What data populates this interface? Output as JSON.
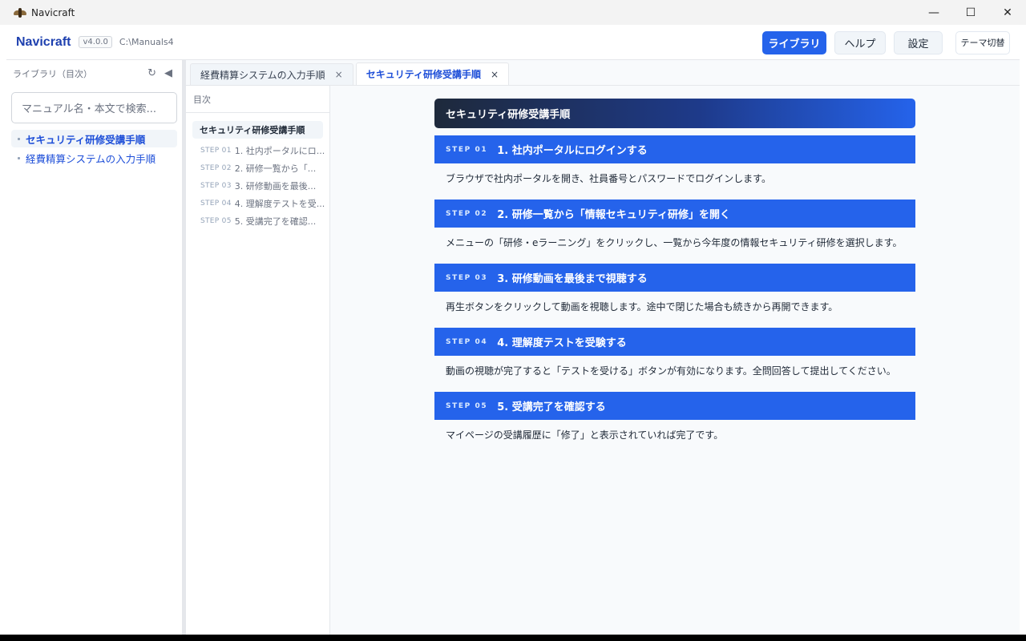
{
  "window": {
    "title": "Navicraft",
    "controls": {
      "minimize": "—",
      "maximize": "☐",
      "close": "✕"
    }
  },
  "header": {
    "brand": "Navicraft",
    "version": "v4.0.0",
    "path": "C:\\Manuals4",
    "buttons": {
      "library": "ライブラリ",
      "help": "ヘルプ",
      "settings": "設定",
      "theme": "テーマ切替"
    }
  },
  "sidebar": {
    "title": "ライブラリ（目次）",
    "refresh_icon": "↻",
    "collapse_icon": "◀",
    "search_placeholder": "マニュアル名・本文で検索...",
    "items": [
      {
        "label": "セキュリティ研修受講手順",
        "active": true
      },
      {
        "label": "経費精算システムの入力手順",
        "active": false
      }
    ]
  },
  "tabs": [
    {
      "label": "経費精算システムの入力手順",
      "close": "×",
      "active": false
    },
    {
      "label": "セキュリティ研修受講手順",
      "close": "×",
      "active": true
    }
  ],
  "toc": {
    "header": "目次",
    "title": "セキュリティ研修受講手順",
    "items": [
      {
        "step": "STEP 01",
        "label": "1. 社内ポータルにロ..."
      },
      {
        "step": "STEP 02",
        "label": "2. 研修一覧から「..."
      },
      {
        "step": "STEP 03",
        "label": "3. 研修動画を最後..."
      },
      {
        "step": "STEP 04",
        "label": "4. 理解度テストを受..."
      },
      {
        "step": "STEP 05",
        "label": "5. 受講完了を確認..."
      }
    ]
  },
  "document": {
    "title": "セキュリティ研修受講手順",
    "steps": [
      {
        "num": "STEP 01",
        "title": "1. 社内ポータルにログインする",
        "body": "ブラウザで社内ポータルを開き、社員番号とパスワードでログインします。"
      },
      {
        "num": "STEP 02",
        "title": "2. 研修一覧から「情報セキュリティ研修」を開く",
        "body": "メニューの「研修・eラーニング」をクリックし、一覧から今年度の情報セキュリティ研修を選択します。"
      },
      {
        "num": "STEP 03",
        "title": "3. 研修動画を最後まで視聴する",
        "body": "再生ボタンをクリックして動画を視聴します。途中で閉じた場合も続きから再開できます。"
      },
      {
        "num": "STEP 04",
        "title": "4. 理解度テストを受験する",
        "body": "動画の視聴が完了すると「テストを受ける」ボタンが有効になります。全問回答して提出してください。"
      },
      {
        "num": "STEP 05",
        "title": "5. 受講完了を確認する",
        "body": "マイページの受講履歴に「修了」と表示されていれば完了です。"
      }
    ]
  },
  "colors": {
    "accent": "#2563eb",
    "brand": "#1e40af"
  }
}
